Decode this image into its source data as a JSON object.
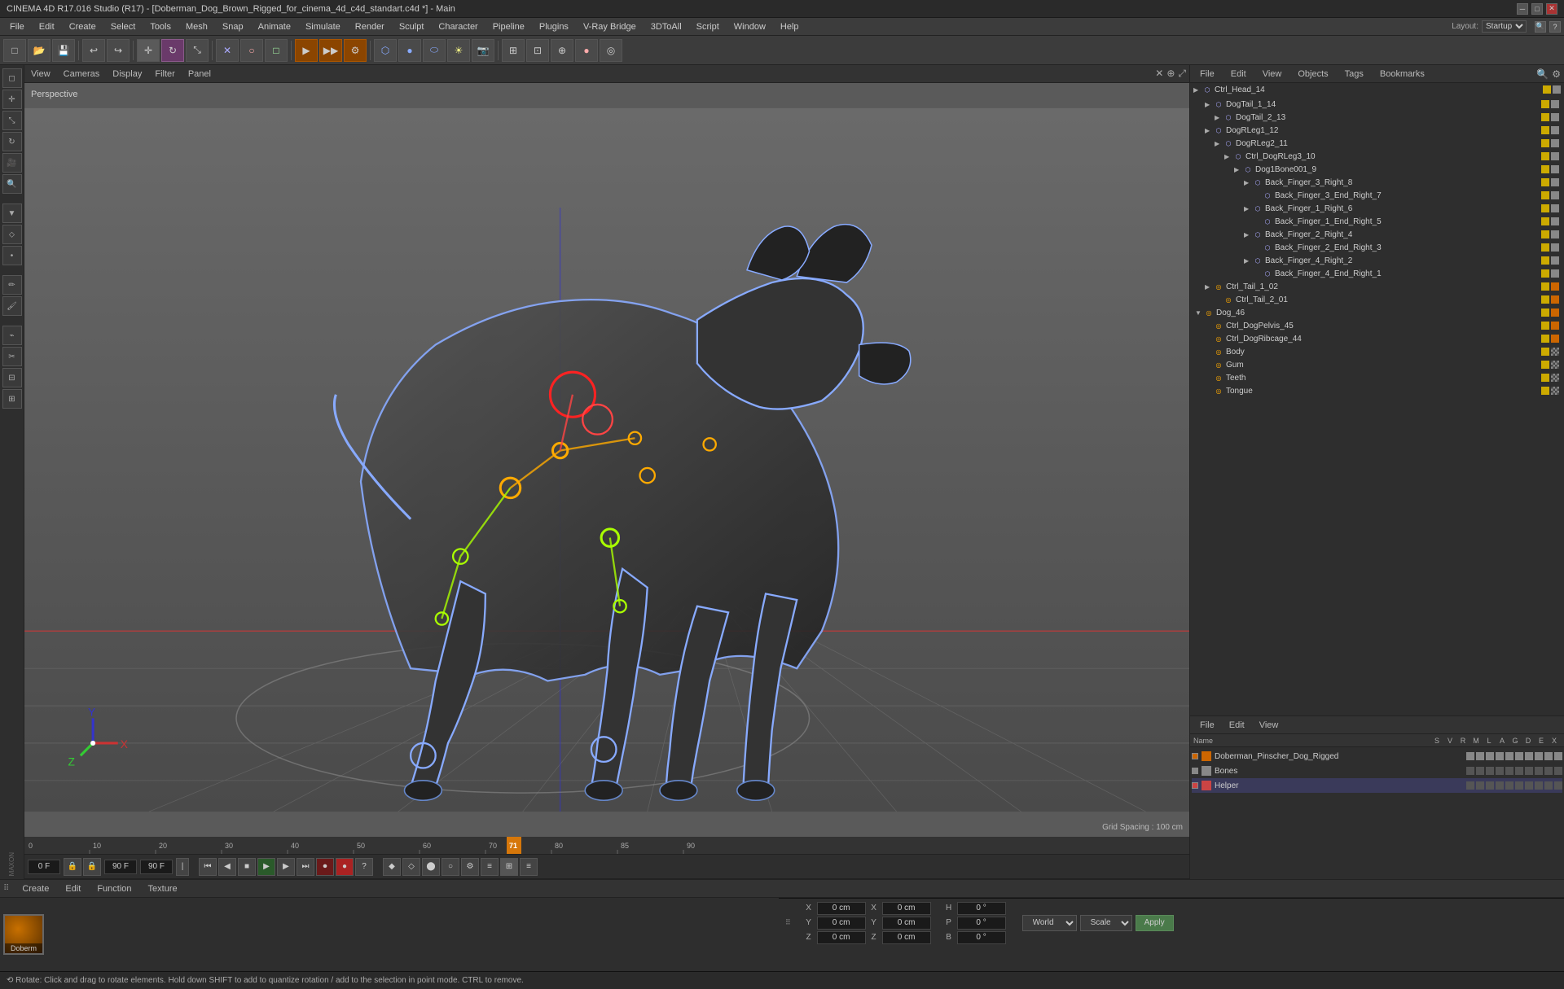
{
  "titlebar": {
    "text": "CINEMA 4D R17.016 Studio (R17) - [Doberman_Dog_Brown_Rigged_for_cinema_4d_c4d_standart.c4d *] - Main",
    "minimize": "─",
    "maximize": "□",
    "close": "✕"
  },
  "menu": {
    "items": [
      "File",
      "Edit",
      "Create",
      "Select",
      "Tools",
      "Mesh",
      "Snap",
      "Animate",
      "Simulate",
      "Render",
      "Sculpt",
      "Character",
      "Pipeline",
      "Plugins",
      "V-Ray Bridge",
      "3DToAll",
      "Script",
      "Window",
      "Help"
    ]
  },
  "layout": {
    "label": "Layout:",
    "preset": "Startup"
  },
  "viewport": {
    "perspective_label": "Perspective",
    "grid_spacing": "Grid Spacing : 100 cm",
    "toolbar_items": [
      "View",
      "Cameras",
      "Display",
      "Filter",
      "Panel"
    ]
  },
  "scene_tree": {
    "tabs": [
      "File",
      "Edit",
      "View",
      "Objects",
      "Tags",
      "Bookmarks"
    ],
    "root": "Ctrl_Head_14",
    "items": [
      {
        "id": "DogTail_1_14",
        "indent": 1,
        "arrow": "▶",
        "label": "DogTail_1_14",
        "dot1": "yellow",
        "dot2": "gray"
      },
      {
        "id": "DogTail_2_13",
        "indent": 2,
        "arrow": "▶",
        "label": "DogTail_2_13",
        "dot1": "yellow",
        "dot2": "gray"
      },
      {
        "id": "DogRLeg1_12",
        "indent": 1,
        "arrow": "▶",
        "label": "DogRLeg1_12",
        "dot1": "yellow",
        "dot2": "gray"
      },
      {
        "id": "DogRLeg2_11",
        "indent": 2,
        "arrow": "▶",
        "label": "DogRLeg2_11",
        "dot1": "yellow",
        "dot2": "gray"
      },
      {
        "id": "Ctrl_DogRLeg3_10",
        "indent": 3,
        "arrow": "▶",
        "label": "Ctrl_DogRLeg3_10",
        "dot1": "yellow",
        "dot2": "gray"
      },
      {
        "id": "Dog1Bone001_9",
        "indent": 4,
        "arrow": "▶",
        "label": "Dog1Bone001_9",
        "dot1": "yellow",
        "dot2": "gray"
      },
      {
        "id": "Back_Finger_3_Right_8",
        "indent": 5,
        "arrow": "▶",
        "label": "Back_Finger_3_Right_8",
        "dot1": "yellow",
        "dot2": "gray"
      },
      {
        "id": "Back_Finger_3_End_Right_7",
        "indent": 6,
        "arrow": " ",
        "label": "Back_Finger_3_End_Right_7",
        "dot1": "yellow",
        "dot2": "gray"
      },
      {
        "id": "Back_Finger_1_Right_6",
        "indent": 5,
        "arrow": "▶",
        "label": "Back_Finger_1_Right_6",
        "dot1": "yellow",
        "dot2": "gray"
      },
      {
        "id": "Back_Finger_1_End_Right_5",
        "indent": 6,
        "arrow": " ",
        "label": "Back_Finger_1_End_Right_5",
        "dot1": "yellow",
        "dot2": "gray"
      },
      {
        "id": "Back_Finger_2_Right_4",
        "indent": 5,
        "arrow": "▶",
        "label": "Back_Finger_2_Right_4",
        "dot1": "yellow",
        "dot2": "gray"
      },
      {
        "id": "Back_Finger_2_End_Right_3",
        "indent": 6,
        "arrow": " ",
        "label": "Back_Finger_2_End_Right_3",
        "dot1": "yellow",
        "dot2": "gray"
      },
      {
        "id": "Back_Finger_4_Right_2",
        "indent": 5,
        "arrow": "▶",
        "label": "Back_Finger_4_Right_2",
        "dot1": "yellow",
        "dot2": "gray"
      },
      {
        "id": "Back_Finger_4_End_Right_1",
        "indent": 6,
        "arrow": " ",
        "label": "Back_Finger_4_End_Right_1",
        "dot1": "yellow",
        "dot2": "gray"
      },
      {
        "id": "Ctrl_Tail_1_02",
        "indent": 1,
        "arrow": "▶",
        "label": "Ctrl_Tail_1_02",
        "dot1": "yellow",
        "dot2": "gray"
      },
      {
        "id": "Ctrl_Tail_2_01",
        "indent": 2,
        "arrow": " ",
        "label": "Ctrl_Tail_2_01",
        "dot1": "yellow",
        "dot2": "gray"
      },
      {
        "id": "Dog_46",
        "indent": 0,
        "arrow": "▼",
        "label": "Dog_46",
        "dot1": "yellow",
        "dot2": "gray"
      },
      {
        "id": "Ctrl_DogPelvis_45",
        "indent": 1,
        "arrow": " ",
        "label": "Ctrl_DogPelvis_45",
        "dot1": "yellow",
        "dot2": "gray"
      },
      {
        "id": "Ctrl_DogRibcage_44",
        "indent": 1,
        "arrow": " ",
        "label": "Ctrl_DogRibcage_44",
        "dot1": "yellow",
        "dot2": "gray"
      },
      {
        "id": "Body",
        "indent": 1,
        "arrow": " ",
        "label": "Body",
        "dot1": "yellow",
        "dot2": "checker"
      },
      {
        "id": "Gum",
        "indent": 1,
        "arrow": " ",
        "label": "Gum",
        "dot1": "yellow",
        "dot2": "checker"
      },
      {
        "id": "Teeth",
        "indent": 1,
        "arrow": " ",
        "label": "Teeth",
        "dot1": "yellow",
        "dot2": "checker"
      },
      {
        "id": "Tongue",
        "indent": 1,
        "arrow": " ",
        "label": "Tongue",
        "dot1": "yellow",
        "dot2": "checker"
      }
    ]
  },
  "attributes": {
    "tabs": [
      "File",
      "Edit",
      "View"
    ],
    "columns": {
      "name": "Name",
      "s": "S",
      "v": "V",
      "r": "R",
      "m": "M",
      "l": "L",
      "a": "A",
      "g": "G",
      "d": "D",
      "e": "E",
      "x": "X"
    },
    "items": [
      {
        "label": "Doberman_Pinscher_Dog_Rigged",
        "color": "#cc6600",
        "checked": true
      },
      {
        "label": "Bones",
        "color": "#888888",
        "checked": true
      },
      {
        "label": "Helper",
        "color": "#cc4444",
        "checked": true
      }
    ]
  },
  "timeline": {
    "frame_start": "0 F",
    "frame_end": "90 F",
    "frame_current": "71 F",
    "playback_fps": "90 F",
    "markers": [
      0,
      10,
      20,
      30,
      40,
      50,
      60,
      70,
      80,
      90
    ],
    "current_frame": 71
  },
  "materials": {
    "tabs": [
      "Create",
      "Edit",
      "Function",
      "Texture"
    ],
    "items": [
      {
        "name": "Doberm",
        "color_center": "#c87000",
        "color_edge": "#5a3000"
      }
    ]
  },
  "coordinates": {
    "x_pos": "0 cm",
    "y_pos": "0 cm",
    "z_pos": "0 cm",
    "x_rot": "0 cm",
    "y_rot": "0 cm",
    "z_rot": "0 cm",
    "h": "0 °",
    "p": "0 °",
    "b": "0 °",
    "world_label": "World",
    "scale_label": "Scale",
    "apply_label": "Apply"
  },
  "status": {
    "text": "⟲ Rotate: Click and drag to rotate elements. Hold down SHIFT to add to quantize rotation / add to the selection in point mode. CTRL to remove."
  },
  "icons": {
    "undo": "↩",
    "redo": "↪",
    "move": "✛",
    "rotate": "↻",
    "scale": "⤡",
    "render": "▶",
    "camera": "📷",
    "play": "▶",
    "stop": "■",
    "rewind": "◀◀",
    "forward": "▶▶",
    "record": "⏺",
    "first": "⏮",
    "last": "⏭"
  }
}
